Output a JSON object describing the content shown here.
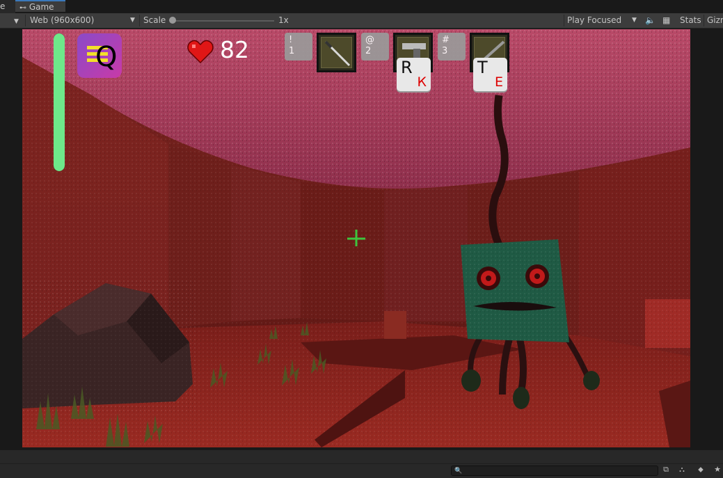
{
  "tabs": {
    "prev_label": "e",
    "game_label": "Game"
  },
  "toolbar": {
    "resolution": "Web (960x600)",
    "scale_label": "Scale",
    "scale_value": "1x",
    "play_mode": "Play Focused",
    "stats_label": "Stats",
    "gizmos_label": "Gizm"
  },
  "hud": {
    "health_value": "82",
    "health_fraction": 0.8,
    "quest_key": "Q",
    "slots": [
      {
        "symbol": "!",
        "number": "1",
        "item": "knife"
      },
      {
        "symbol": "@",
        "number": "2",
        "item": "pistol"
      },
      {
        "symbol": "#",
        "number": "3",
        "item": "rifle"
      }
    ],
    "key_hints": [
      {
        "latin": "R",
        "cyrillic": "К"
      },
      {
        "latin": "T",
        "cyrillic": "Е"
      }
    ]
  },
  "colors": {
    "stamina_bar": "#6ee88a",
    "ceiling": "#c54a6a",
    "wall": "#8a2a22",
    "floor": "#7a1a1a",
    "crosshair": "#3ec43e",
    "monster_face": "#1f5a44"
  }
}
